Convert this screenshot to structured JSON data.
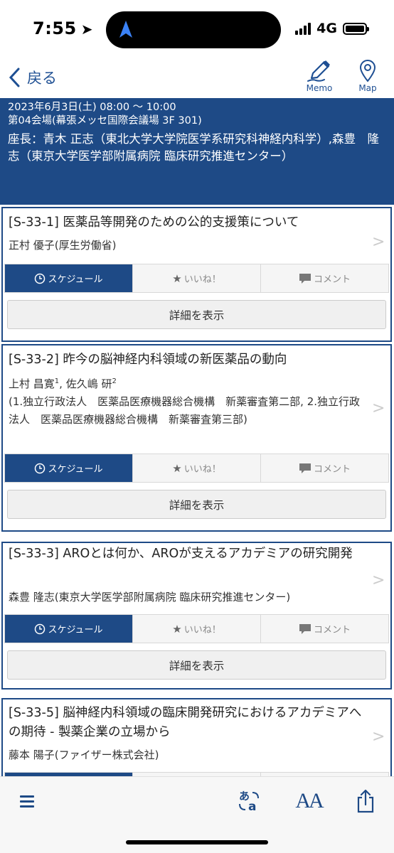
{
  "status": {
    "time": "7:55",
    "network": "4G"
  },
  "header": {
    "back_label": "戻る",
    "memo_label": "Memo",
    "map_label": "Map"
  },
  "session": {
    "date": "2023年6月3日(土) 08:00 〜 10:00",
    "venue": "第04会場(幕張メッセ国際会議場 3F 301)",
    "chair": "座長：青木 正志（東北大学大学院医学系研究科神経内科学）,森豊　隆志（東京大学医学部附属病院 臨床研究推進センター）"
  },
  "labels": {
    "schedule": "スケジュール",
    "like": "いいね！",
    "comment": "コメント",
    "detail": "詳細を表示"
  },
  "items": [
    {
      "title": "[S-33-1] 医薬品等開発のための公的支援策について",
      "authors": "正村 優子(厚生労働省)"
    },
    {
      "title": "[S-33-2] 昨今の脳神経内科領域の新医薬品の動向",
      "author1": "上村 昌寛",
      "sup1": "1",
      "author2": ", 佐久嶋 研",
      "sup2": "2",
      "affiliation": "(1.独立行政法人　医薬品医療機器総合機構　新薬審査第二部, 2.独立行政法人　医薬品医療機器総合機構　新薬審査第三部)"
    },
    {
      "title": "[S-33-3] AROとは何か、AROが支えるアカデミアの研究開発",
      "authors": "森豊 隆志(東京大学医学部附属病院 臨床研究推進センター)"
    },
    {
      "title": "[S-33-5] 脳神経内科領域の臨床開発研究におけるアカデミアへの期待 - 製薬企業の立場から",
      "authors": "藤本 陽子(ファイザー株式会社)"
    }
  ],
  "chevron": ">",
  "toolbar": {
    "font_size_label": "AA"
  }
}
